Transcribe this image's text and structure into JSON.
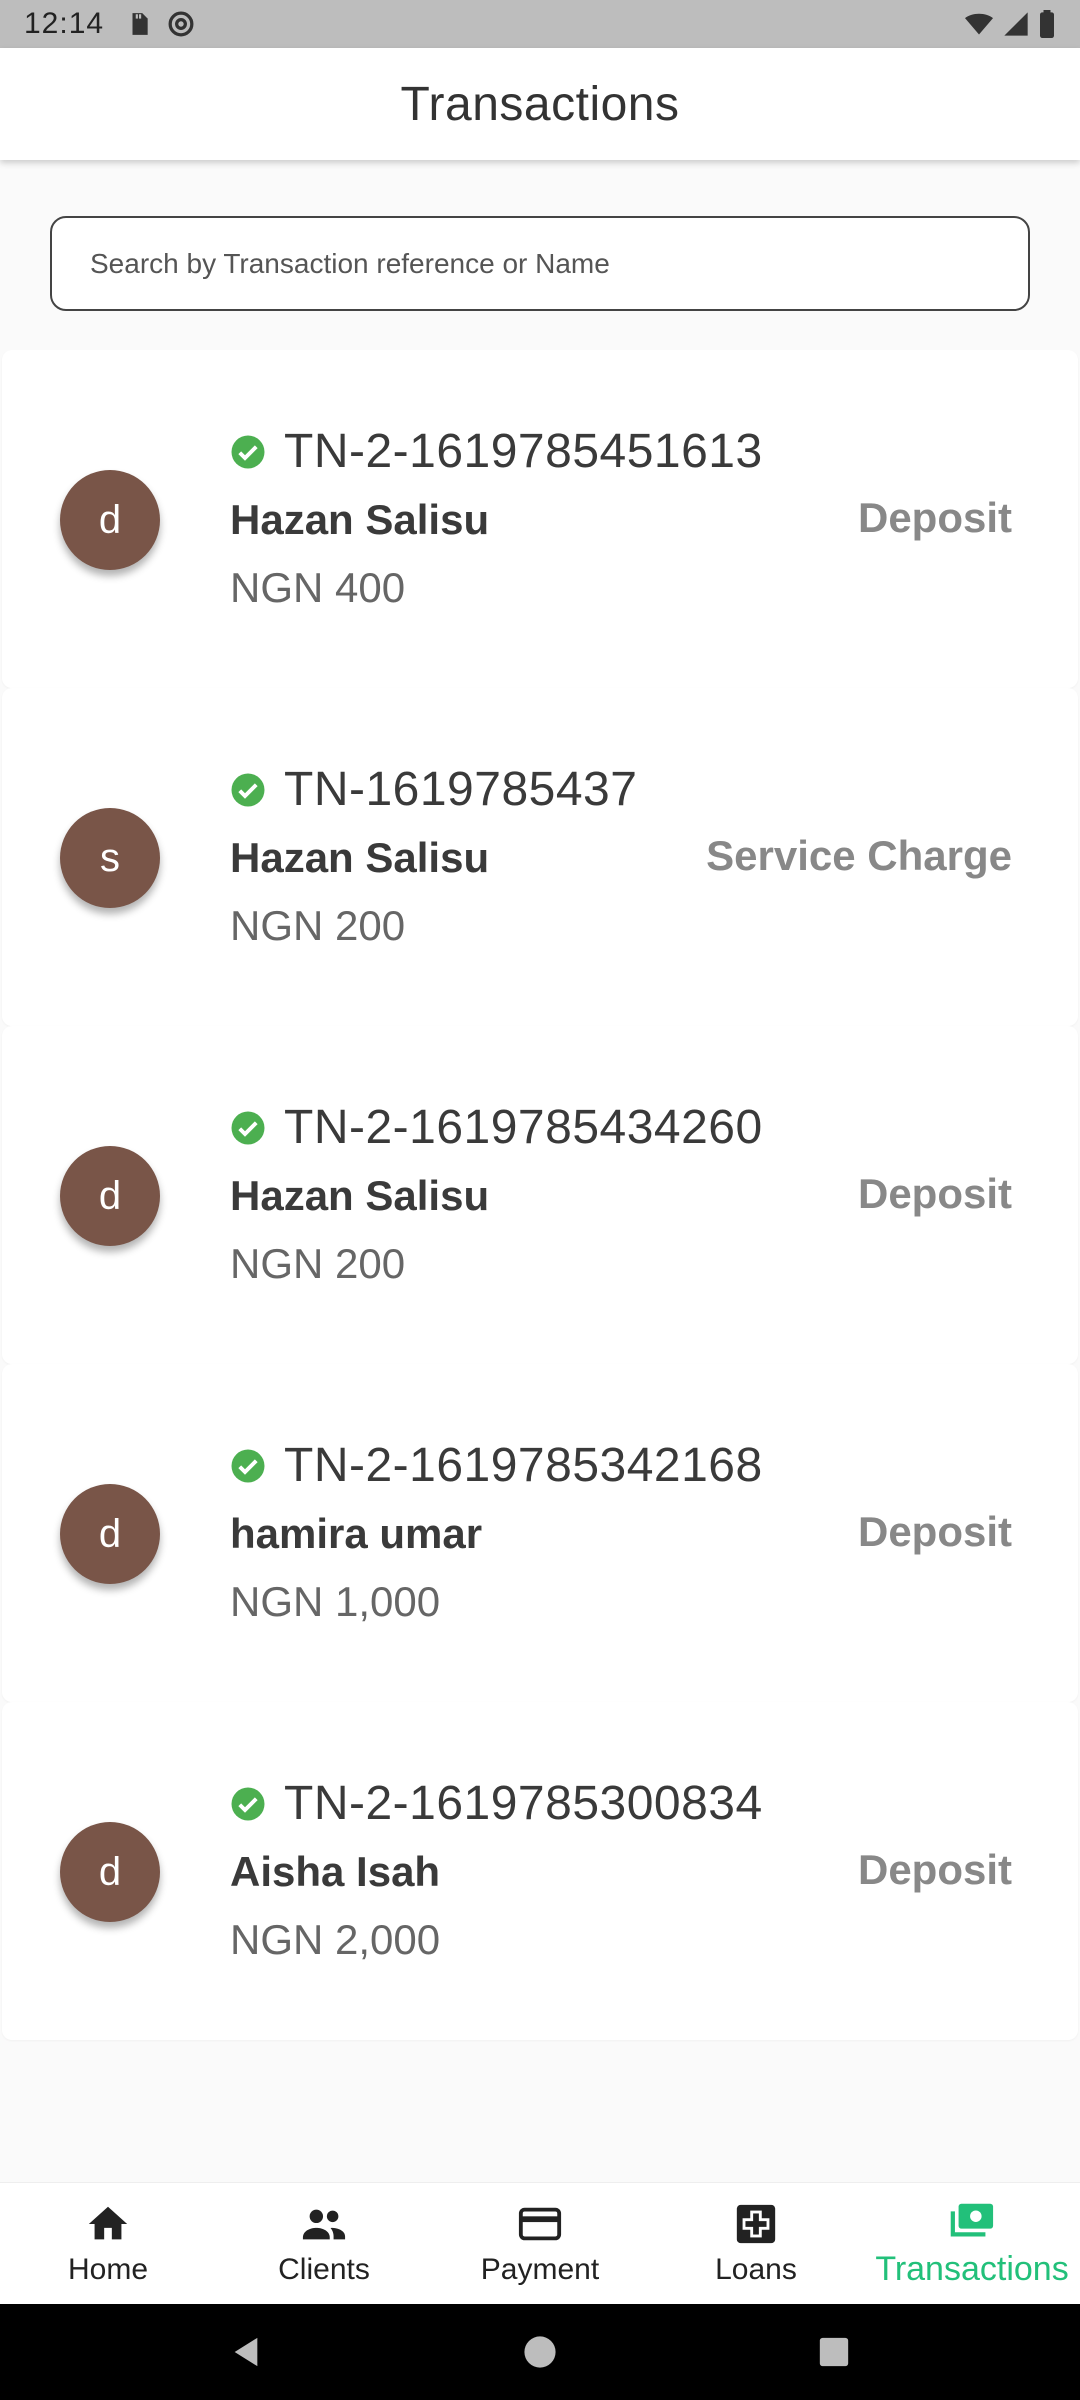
{
  "status_bar": {
    "time": "12:14"
  },
  "app_bar": {
    "title": "Transactions"
  },
  "search": {
    "placeholder": "Search by Transaction reference or Name",
    "value": ""
  },
  "transactions": [
    {
      "initial": "d",
      "reference": "TN-2-1619785451613",
      "name": "Hazan Salisu",
      "amount": "NGN 400",
      "type": "Deposit",
      "status": "success"
    },
    {
      "initial": "s",
      "reference": "TN-1619785437",
      "name": "Hazan Salisu",
      "amount": "NGN 200",
      "type": "Service Charge",
      "status": "success"
    },
    {
      "initial": "d",
      "reference": "TN-2-1619785434260",
      "name": "Hazan Salisu",
      "amount": "NGN 200",
      "type": "Deposit",
      "status": "success"
    },
    {
      "initial": "d",
      "reference": "TN-2-1619785342168",
      "name": "hamira umar",
      "amount": "NGN 1,000",
      "type": "Deposit",
      "status": "success"
    },
    {
      "initial": "d",
      "reference": "TN-2-1619785300834",
      "name": "Aisha Isah",
      "amount": "NGN 2,000",
      "type": "Deposit",
      "status": "success"
    }
  ],
  "bottom_nav": {
    "items": [
      {
        "label": "Home",
        "icon": "home-icon",
        "active": false
      },
      {
        "label": "Clients",
        "icon": "people-icon",
        "active": false
      },
      {
        "label": "Payment",
        "icon": "credit-card-icon",
        "active": false
      },
      {
        "label": "Loans",
        "icon": "loan-icon",
        "active": false
      },
      {
        "label": "Transactions",
        "icon": "money-icon",
        "active": true
      }
    ]
  },
  "colors": {
    "accent": "#22c07a",
    "avatar": "#795548",
    "success": "#4caf50"
  }
}
